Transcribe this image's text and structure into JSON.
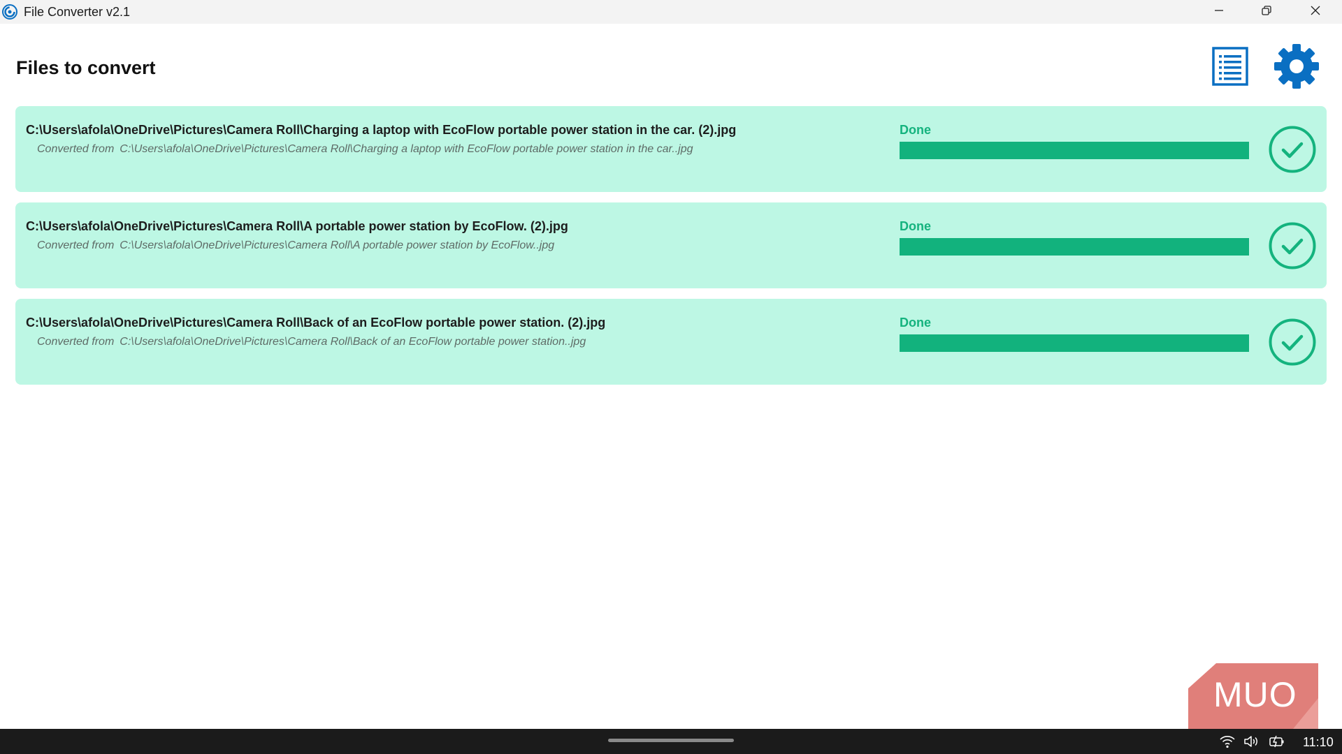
{
  "app": {
    "title": "File Converter v2.1",
    "icon": "file-converter-logo"
  },
  "window_controls": {
    "minimize": "minimize-icon",
    "maximize": "restore-icon",
    "close": "close-icon"
  },
  "header": {
    "title": "Files to convert",
    "list_button_icon": "list-icon",
    "settings_button_icon": "gear-icon"
  },
  "files": [
    {
      "output_path": "C:\\Users\\afola\\OneDrive\\Pictures\\Camera Roll\\Charging a laptop with EcoFlow portable power station in the car. (2).jpg",
      "source_prefix": "Converted from",
      "source_path": "C:\\Users\\afola\\OneDrive\\Pictures\\Camera Roll\\Charging a laptop with EcoFlow portable power station in the car..jpg",
      "status": "Done",
      "progress": 1.0
    },
    {
      "output_path": "C:\\Users\\afola\\OneDrive\\Pictures\\Camera Roll\\A portable power station by EcoFlow. (2).jpg",
      "source_prefix": "Converted from",
      "source_path": "C:\\Users\\afola\\OneDrive\\Pictures\\Camera Roll\\A portable power station by EcoFlow..jpg",
      "status": "Done",
      "progress": 1.0
    },
    {
      "output_path": "C:\\Users\\afola\\OneDrive\\Pictures\\Camera Roll\\Back of an EcoFlow portable power station. (2).jpg",
      "source_prefix": "Converted from",
      "source_path": "C:\\Users\\afola\\OneDrive\\Pictures\\Camera Roll\\Back of an EcoFlow portable power station..jpg",
      "status": "Done",
      "progress": 1.0
    }
  ],
  "watermark": {
    "text": "MUO"
  },
  "taskbar": {
    "time": "11:10",
    "tray_icons": [
      "wifi-icon",
      "volume-icon",
      "battery-icon"
    ]
  },
  "colors": {
    "accent_blue": "#0a6fc2",
    "card_background": "#bdf7e4",
    "status_green": "#14b37e",
    "progress_fill": "#12b27d",
    "watermark_red": "#e07f7a"
  }
}
